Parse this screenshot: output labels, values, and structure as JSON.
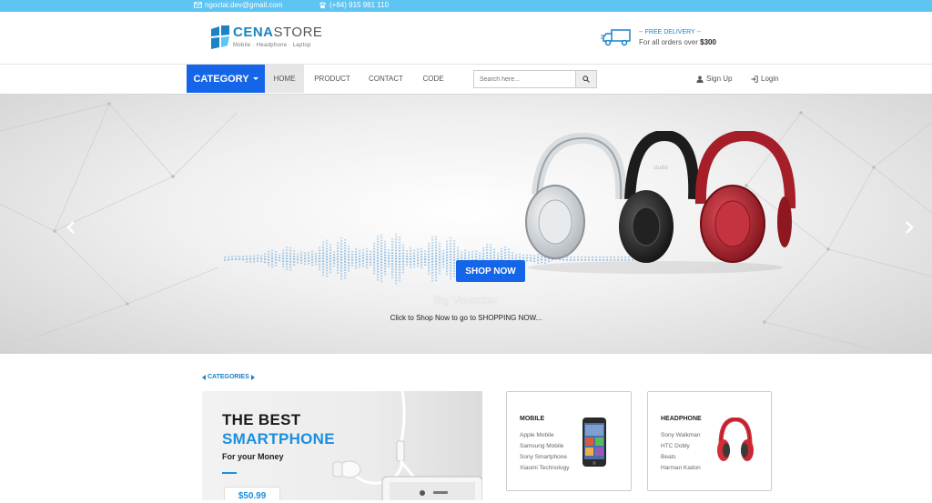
{
  "topbar": {
    "email": "ngoctai.dev@gmail.com",
    "phone": "(+84) 915 981 110",
    "email_icon": "envelope-icon",
    "phone_icon": "phone-icon"
  },
  "header": {
    "brand_bold": "CENA",
    "brand_light": "STORE",
    "tagline": "Mobile · Headphone · Laptop",
    "delivery_title": "-- FREE DELIVERY --",
    "delivery_text": "For all orders over",
    "delivery_amount": "$300"
  },
  "nav": {
    "category_label": "CATEGORY",
    "links": [
      "HOME",
      "PRODUCT",
      "CONTACT",
      "CODE"
    ],
    "active": "HOME",
    "search_placeholder": "Search here...",
    "signup_label": "Sign Up",
    "login_label": "Login"
  },
  "hero": {
    "button_label": "SHOP NOW",
    "title": "Big Vauncher",
    "subtitle": "Click to Shop Now to go to SHOPPING NOW...",
    "headphone_brand": "studio"
  },
  "section": {
    "categories_label": "CATEGORIES"
  },
  "promo": {
    "line1": "THE BEST",
    "line2": "SMARTPHONE",
    "line3": "For your Money",
    "price": "$50.99"
  },
  "cards": [
    {
      "title": "MOBILE",
      "items": [
        "Apple Mobile",
        "Samsung Mobile",
        "Sony Smartphone",
        "Xiaomi Technology"
      ]
    },
    {
      "title": "HEADPHONE",
      "items": [
        "Sony Walkman",
        "HTC Dobly",
        "Beats",
        "Harman Kadon"
      ]
    }
  ],
  "colors": {
    "topbar": "#5ec4f2",
    "primary": "#1565e8",
    "brand": "#1b82c5"
  }
}
